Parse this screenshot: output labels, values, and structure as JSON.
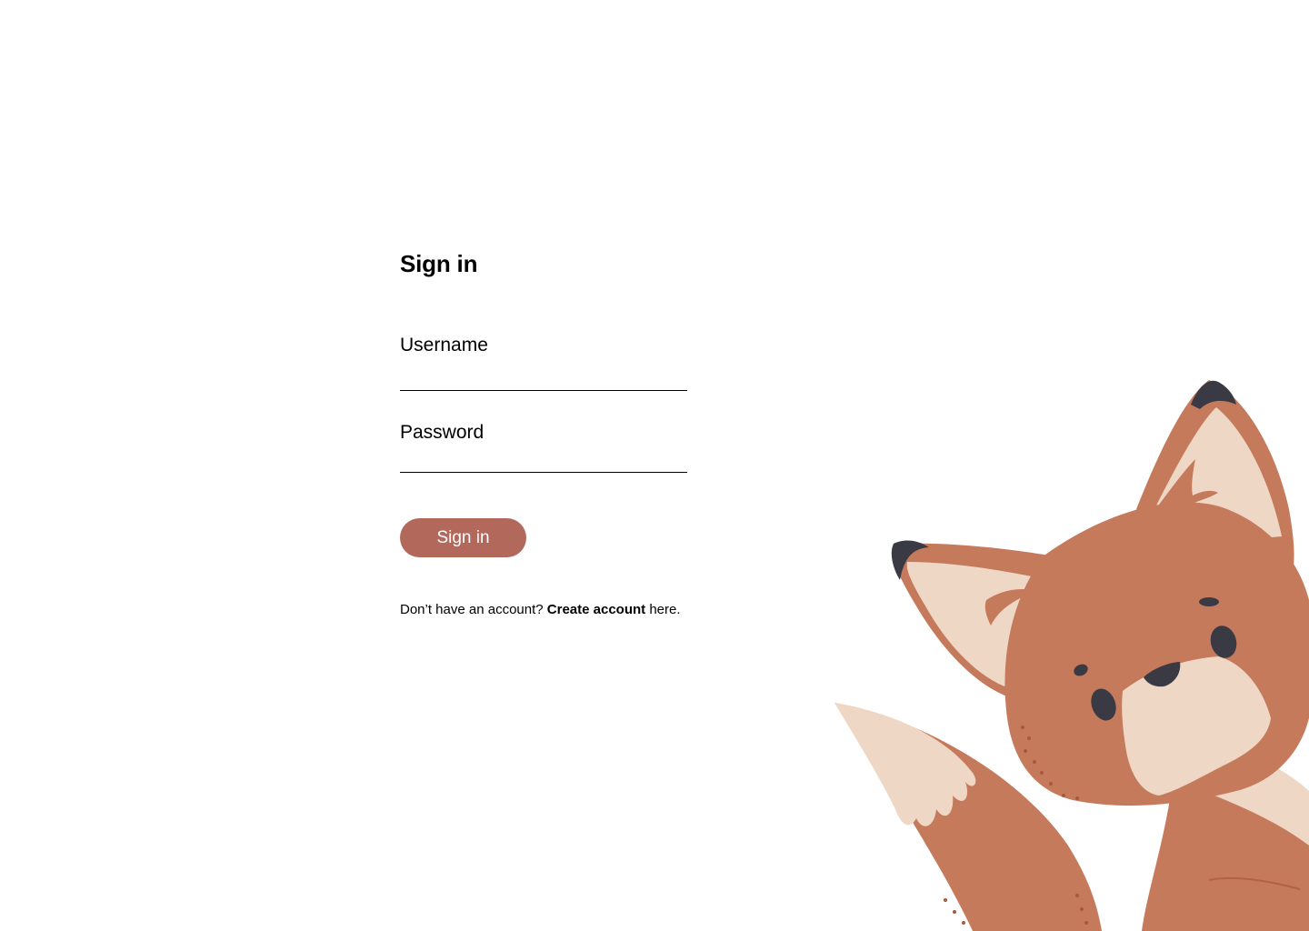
{
  "title": "Sign in",
  "username": {
    "label": "Username",
    "value": "",
    "placeholder": ""
  },
  "password": {
    "label": "Password",
    "value": "",
    "placeholder": ""
  },
  "submit_label": "Sign in",
  "signup": {
    "prefix": "Don’t have an account?",
    "link_label": "Create account",
    "suffix": "here."
  },
  "illustration": {
    "icon": "fox-illustration-icon"
  },
  "colors": {
    "accent": "#b3685c",
    "fox_orange": "#c67a5c",
    "fox_cream": "#eed8c5",
    "fox_dark": "#3a3a44"
  }
}
